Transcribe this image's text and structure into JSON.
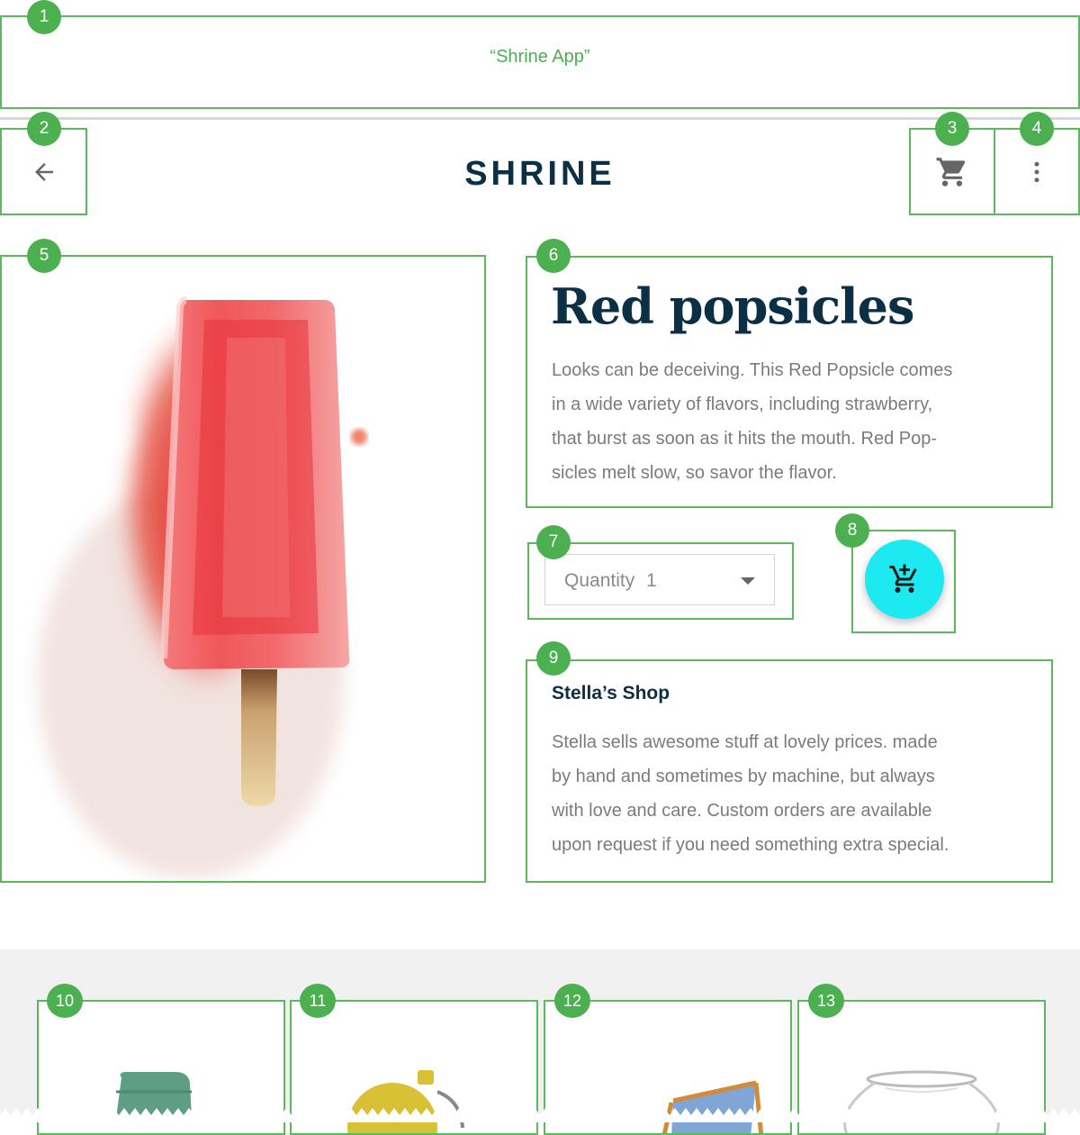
{
  "window": {
    "title": "“Shrine App”"
  },
  "app_bar": {
    "brand": "SHRINE"
  },
  "icons": {
    "back": "arrow-back-icon",
    "cart": "shopping-cart-icon",
    "overflow": "more-vert-icon",
    "add_to_cart": "add-shopping-cart-icon"
  },
  "product": {
    "title": "Red popsicles",
    "description_lines": [
      "Looks can be deceiving. This Red Popsicle comes",
      "in a wide variety of flavors, including strawberry,",
      "that burst as soon as it hits the mouth. Red Pop-",
      "sicles melt slow, so savor the flavor."
    ]
  },
  "quantity": {
    "label": "Quantity",
    "value": "1"
  },
  "shop": {
    "name": "Stella’s Shop",
    "description_lines": [
      "Stella sells awesome stuff at lovely prices. made",
      "by hand and sometimes by machine, but always",
      "with love and care. Custom orders are available",
      "upon request if you need something extra special."
    ]
  },
  "annotations": [
    "1",
    "2",
    "3",
    "4",
    "5",
    "6",
    "7",
    "8",
    "9",
    "10",
    "11",
    "12",
    "13"
  ],
  "colors": {
    "annotation_green": "#4caf50",
    "brand_navy": "#0b2f44",
    "fab_cyan": "#1de9f0",
    "body_grey": "#7b7b7b",
    "grid_background": "#f1f1f1"
  }
}
